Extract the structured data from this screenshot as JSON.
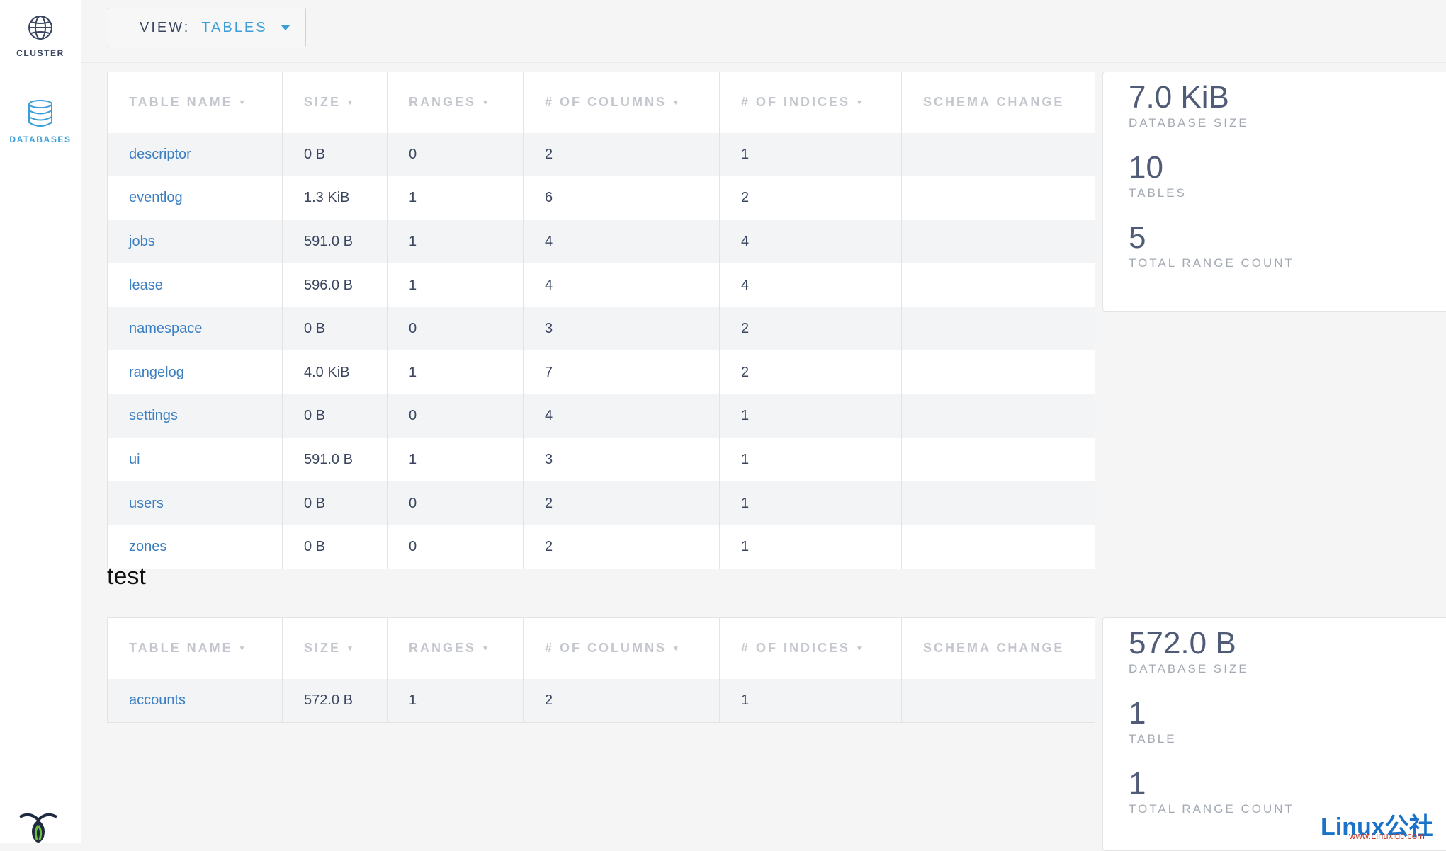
{
  "sidebar": {
    "items": [
      {
        "label": "CLUSTER",
        "icon": "globe-icon"
      },
      {
        "label": "DATABASES",
        "icon": "database-icon"
      }
    ],
    "logo_icon": "cockroach-logo-icon"
  },
  "view_selector": {
    "label": "VIEW:",
    "value": "TABLES",
    "icon": "caret-down-icon"
  },
  "colors": {
    "accent": "#3a9fd8",
    "link": "#3a7fc2",
    "text": "#3a4660",
    "header_text": "#c3c7cd"
  },
  "columns": [
    "TABLE NAME",
    "SIZE",
    "RANGES",
    "# OF COLUMNS",
    "# OF INDICES",
    "SCHEMA CHANGE"
  ],
  "databases": [
    {
      "name": "",
      "rows": [
        {
          "table": "descriptor",
          "size": "0 B",
          "ranges": "0",
          "columns": "2",
          "indices": "1",
          "schema": ""
        },
        {
          "table": "eventlog",
          "size": "1.3 KiB",
          "ranges": "1",
          "columns": "6",
          "indices": "2",
          "schema": ""
        },
        {
          "table": "jobs",
          "size": "591.0 B",
          "ranges": "1",
          "columns": "4",
          "indices": "4",
          "schema": ""
        },
        {
          "table": "lease",
          "size": "596.0 B",
          "ranges": "1",
          "columns": "4",
          "indices": "4",
          "schema": ""
        },
        {
          "table": "namespace",
          "size": "0 B",
          "ranges": "0",
          "columns": "3",
          "indices": "2",
          "schema": ""
        },
        {
          "table": "rangelog",
          "size": "4.0 KiB",
          "ranges": "1",
          "columns": "7",
          "indices": "2",
          "schema": ""
        },
        {
          "table": "settings",
          "size": "0 B",
          "ranges": "0",
          "columns": "4",
          "indices": "1",
          "schema": ""
        },
        {
          "table": "ui",
          "size": "591.0 B",
          "ranges": "1",
          "columns": "3",
          "indices": "1",
          "schema": ""
        },
        {
          "table": "users",
          "size": "0 B",
          "ranges": "0",
          "columns": "2",
          "indices": "1",
          "schema": ""
        },
        {
          "table": "zones",
          "size": "0 B",
          "ranges": "0",
          "columns": "2",
          "indices": "1",
          "schema": ""
        }
      ],
      "summary": [
        {
          "value": "7.0 KiB",
          "label": "DATABASE SIZE"
        },
        {
          "value": "10",
          "label": "TABLES"
        },
        {
          "value": "5",
          "label": "TOTAL RANGE COUNT"
        }
      ]
    },
    {
      "name": "test",
      "rows": [
        {
          "table": "accounts",
          "size": "572.0 B",
          "ranges": "1",
          "columns": "2",
          "indices": "1",
          "schema": ""
        }
      ],
      "summary": [
        {
          "value": "572.0 B",
          "label": "DATABASE SIZE"
        },
        {
          "value": "1",
          "label": "TABLE"
        },
        {
          "value": "1",
          "label": "TOTAL RANGE COUNT"
        }
      ]
    }
  ],
  "watermark": {
    "text": "Linux公社",
    "sub": "www.Linuxidc.com"
  }
}
